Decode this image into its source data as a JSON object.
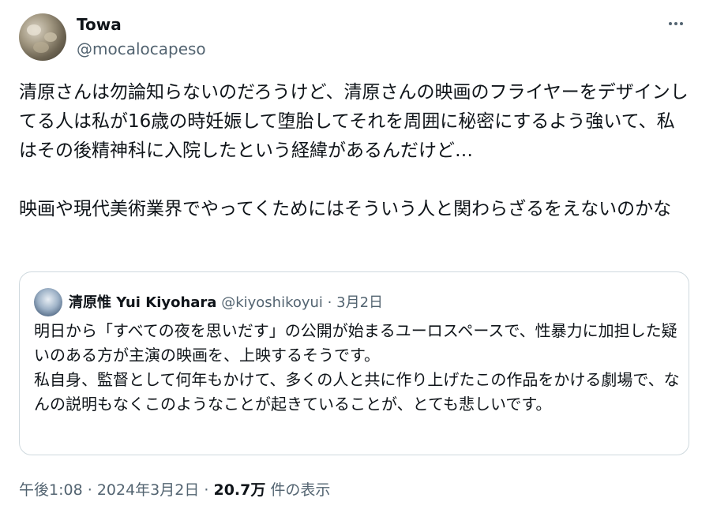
{
  "author": {
    "name": "Towa",
    "handle": "@mocalocapeso"
  },
  "tweet": {
    "text": "清原さんは勿論知らないのだろうけど、清原さんの映画のフライヤーをデザインしてる人は私が16歳の時妊娠して堕胎してそれを周囲に秘密にするよう強いて、私はその後精神科に入院したという経緯があるんだけど…\n\n映画や現代美術業界でやってくためにはそういう人と関わらざるをえないのかな"
  },
  "quote": {
    "name": "清原惟 Yui Kiyohara",
    "handle": "@kiyoshikoyui",
    "separator": "·",
    "date": "3月2日",
    "text": "明日から「すべての夜を思いだす」の公開が始まるユーロスペースで、性暴力に加担した疑いのある方が主演の映画を、上映するそうです。\n私自身、監督として何年もかけて、多くの人と共に作り上げたこの作品をかける劇場で、なんの説明もなくこのようなことが起きていることが、とても悲しいです。"
  },
  "footer": {
    "time": "午後1:08",
    "separator": "·",
    "date": "2024年3月2日",
    "views": "20.7万",
    "views_label": "件の表示"
  },
  "colors": {
    "text_primary": "#0f1419",
    "text_secondary": "#536471",
    "border": "#cfd9de"
  },
  "icons": {
    "more": "more-horizontal-icon"
  }
}
